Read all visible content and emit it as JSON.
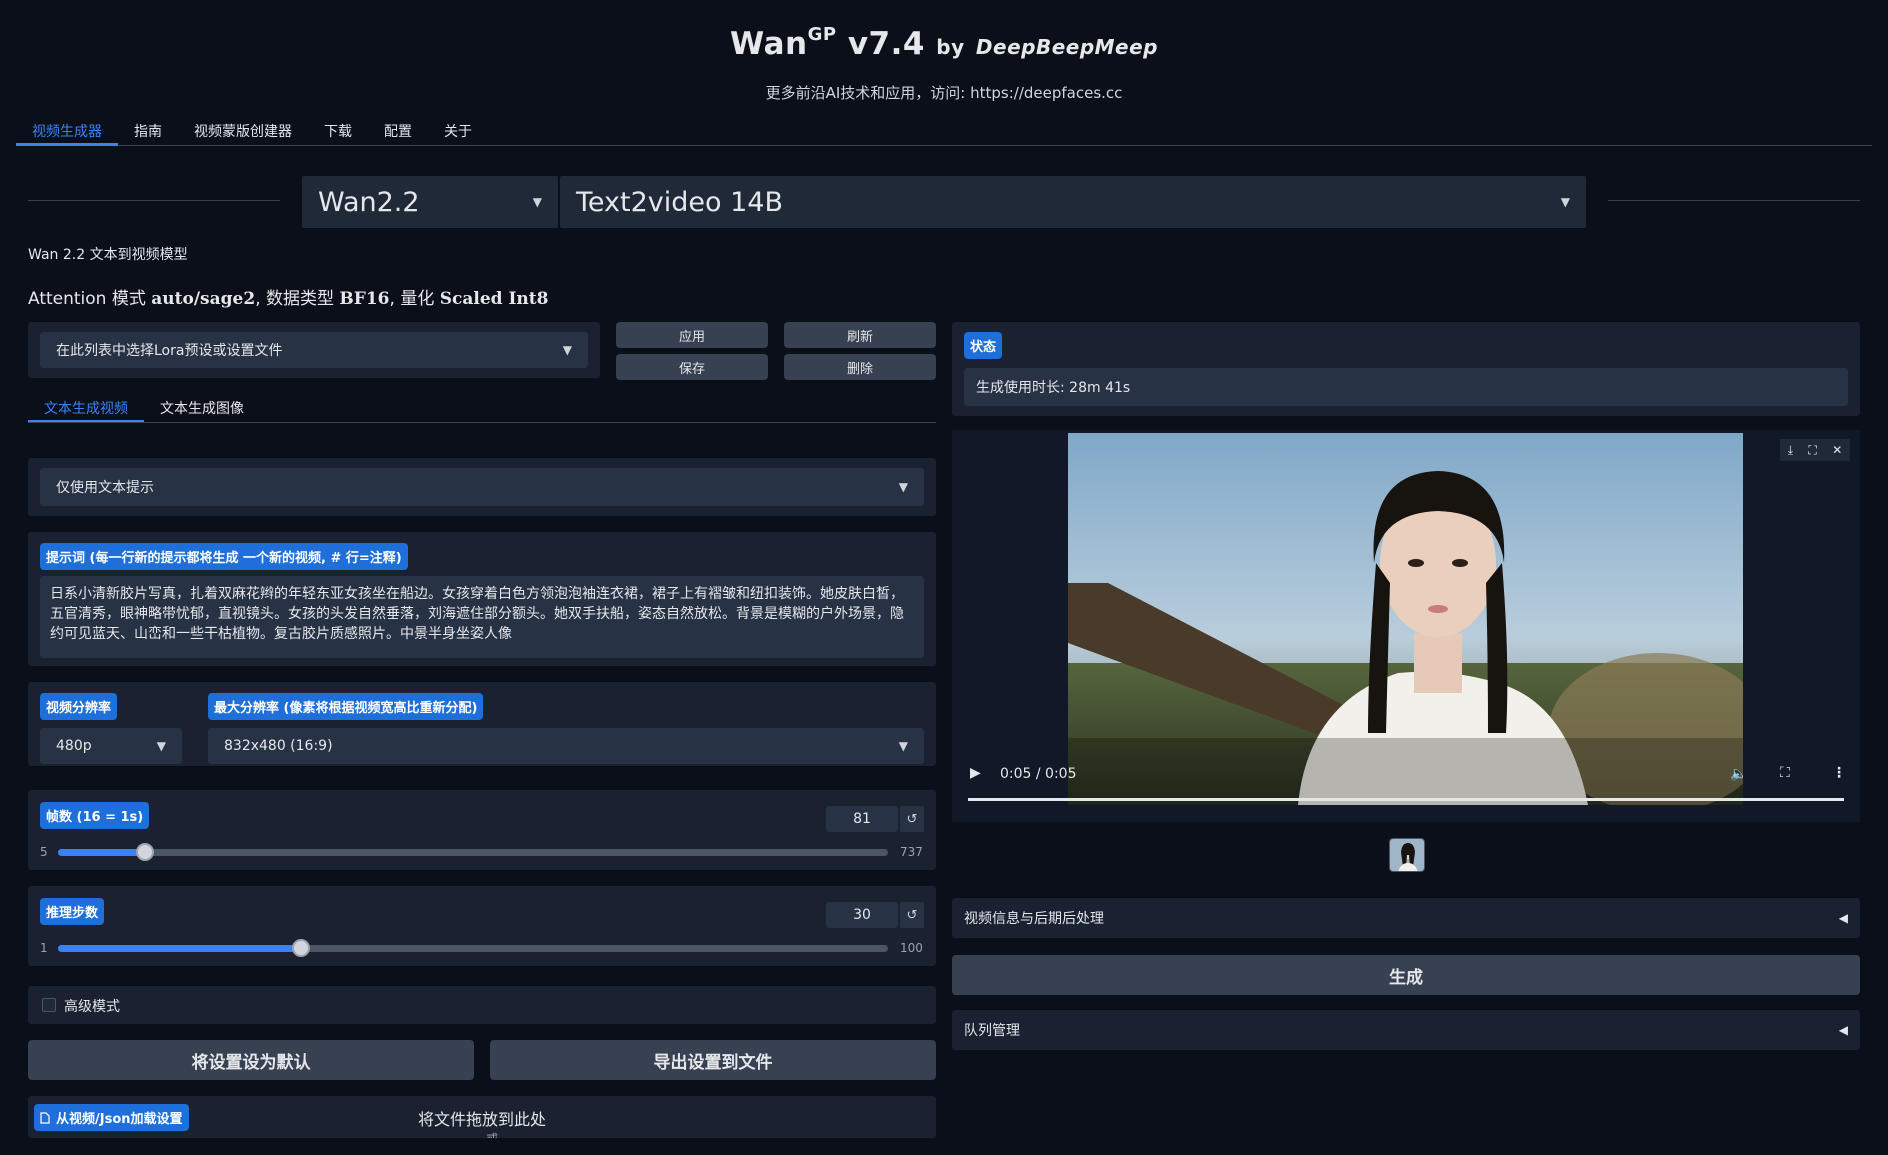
{
  "header": {
    "app_name": "Wan",
    "superscript": "GP",
    "version": "v7.4",
    "by": "by",
    "author": "DeepBeepMeep",
    "subtitle": "更多前沿AI技术和应用，访问: https://deepfaces.cc"
  },
  "tabs": [
    "视频生成器",
    "指南",
    "视频蒙版创建器",
    "下载",
    "配置",
    "关于"
  ],
  "model": {
    "family": "Wan2.2",
    "variant": "Text2video 14B",
    "description": "Wan 2.2 文本到视频模型",
    "attention_prefix": "Attention 模式",
    "attention_value": "auto/sage2",
    "dtype_prefix": ", 数据类型",
    "dtype_value": "BF16",
    "quant_prefix": ", 量化",
    "quant_value": "Scaled Int8"
  },
  "lora": {
    "placeholder": "在此列表中选择Lora预设或设置文件",
    "apply": "应用",
    "refresh": "刷新",
    "save": "保存",
    "delete": "删除"
  },
  "subtabs": [
    "文本生成视频",
    "文本生成图像"
  ],
  "prompt_mode": "仅使用文本提示",
  "prompt": {
    "label": "提示词 (每一行新的提示都将生成 一个新的视频, # 行=注释)",
    "lines": [
      "日系小清新胶片写真，扎着双麻花辫的年轻东亚女孩坐在船边。女孩穿着白色方领泡泡袖连衣裙，裙子上有褶皱和纽扣装饰。她皮肤白皙，",
      "五官清秀，眼神略带忧郁，直视镜头。女孩的头发自然垂落，刘海遮住部分额头。她双手扶船，姿态自然放松。背景是模糊的户外场景，隐",
      "约可见蓝天、山峦和一些干枯植物。复古胶片质感照片。中景半身坐姿人像"
    ]
  },
  "resolution": {
    "label": "视频分辨率",
    "value": "480p",
    "max_label": "最大分辨率 (像素将根据视频宽高比重新分配)",
    "max_value": "832x480 (16:9)"
  },
  "frames": {
    "label": "帧数 (16 = 1s)",
    "value": "81",
    "min": "5",
    "max": "737",
    "fraction": 0.1049
  },
  "steps": {
    "label": "推理步数",
    "value": "30",
    "min": "1",
    "max": "100",
    "fraction": 0.2929
  },
  "reset_glyph": "↺",
  "advanced": {
    "label": "高级模式",
    "checked": false
  },
  "actions": {
    "set_default": "将设置设为默认",
    "export": "导出设置到文件",
    "load_label": "从视频/Json加载设置",
    "drop_text": "将文件拖放到此处",
    "drop_sub": "- 或 -"
  },
  "status": {
    "label": "状态",
    "text": "生成使用时长: 28m 41s"
  },
  "video": {
    "time": "0:05 / 0:05",
    "progress": 1.0,
    "icons": [
      "download-icon",
      "fullscreen-icon",
      "close-icon",
      "play-icon",
      "volume-icon",
      "more-icon"
    ]
  },
  "accordions": {
    "video_info": "视频信息与后期后处理",
    "queue": "队列管理",
    "arrow": "◀"
  },
  "generate": "生成"
}
